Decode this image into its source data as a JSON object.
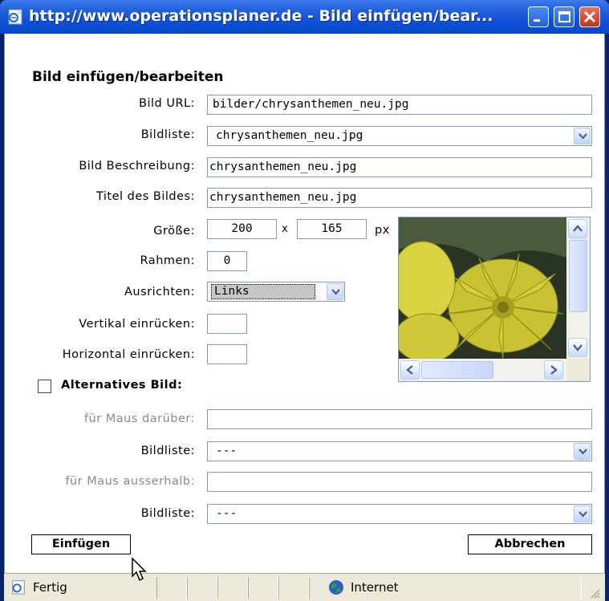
{
  "window": {
    "title": "http://www.operationsplaner.de - Bild einfügen/bear..."
  },
  "form": {
    "heading": "Bild einfügen/bearbeiten",
    "image_url": {
      "label": "Bild URL:",
      "value": "bilder/chrysanthemen_neu.jpg"
    },
    "image_list": {
      "label": "Bildliste:",
      "value": "chrysanthemen_neu.jpg"
    },
    "description": {
      "label": "Bild Beschreibung:",
      "value": "chrysanthemen_neu.jpg"
    },
    "title": {
      "label": "Titel des Bildes:",
      "value": "chrysanthemen_neu.jpg"
    },
    "size": {
      "label": "Größe:",
      "width": "200",
      "separator": "x",
      "height": "165",
      "unit": "px"
    },
    "border": {
      "label": "Rahmen:",
      "value": "0"
    },
    "align": {
      "label": "Ausrichten:",
      "value": "Links"
    },
    "vspace": {
      "label": "Vertikal einrücken:",
      "value": ""
    },
    "hspace": {
      "label": "Horizontal einrücken:",
      "value": ""
    },
    "alt_image": {
      "label": "Alternatives Bild:",
      "checked": false
    },
    "mouse_over": {
      "label": "für Maus darüber:",
      "value": ""
    },
    "mouse_over_list": {
      "label": "Bildliste:",
      "value": "---"
    },
    "mouse_out": {
      "label": "für Maus ausserhalb:",
      "value": ""
    },
    "mouse_out_list": {
      "label": "Bildliste:",
      "value": "---"
    }
  },
  "buttons": {
    "insert": "Einfügen",
    "cancel": "Abbrechen"
  },
  "statusbar": {
    "status": "Fertig",
    "zone": "Internet"
  },
  "colors": {
    "titlebar": "#0b4fd6",
    "field_border": "#7f9db9",
    "disabled_label": "#8a8a8a"
  }
}
